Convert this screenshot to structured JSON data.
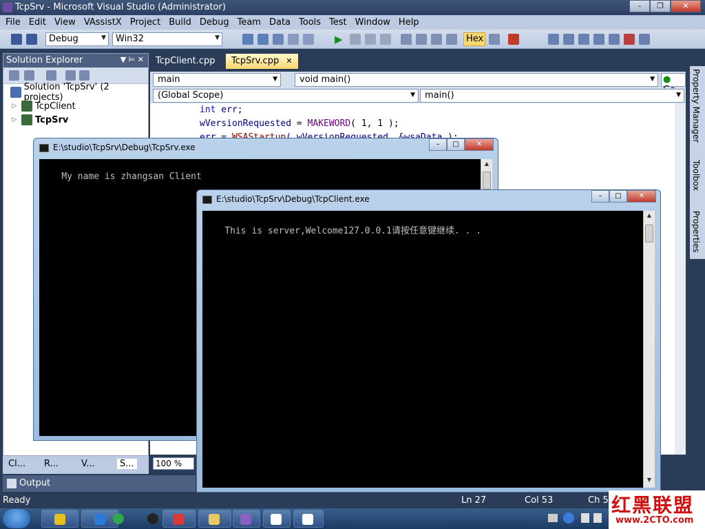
{
  "window": {
    "title": "TcpSrv - Microsoft Visual Studio (Administrator)"
  },
  "menu": [
    "File",
    "Edit",
    "View",
    "VAssistX",
    "Project",
    "Build",
    "Debug",
    "Team",
    "Data",
    "Tools",
    "Test",
    "Window",
    "Help"
  ],
  "toolbar": {
    "config": "Debug",
    "platform": "Win32",
    "hex_label": "Hex"
  },
  "solution_explorer": {
    "title": "Solution Explorer",
    "solution": "Solution 'TcpSrv' (2 projects)",
    "projects": [
      "TcpClient",
      "TcpSrv"
    ]
  },
  "bottom_tabs": [
    "Cl...",
    "R...",
    "V...",
    "S..."
  ],
  "doc_tabs": [
    "TcpClient.cpp",
    "TcpSrv.cpp"
  ],
  "nav": {
    "left": "main",
    "right": "void main()",
    "scope": "(Global Scope)",
    "member": "main()",
    "go": "Go"
  },
  "code": {
    "l1_kw": "int",
    "l1_rest": " err;",
    "l2_ident": "wVersionRequested",
    "l2_eq": " = ",
    "l2_macro": "MAKEWORD",
    "l2_rest": "( 1, 1 );",
    "l3_a": "err = ",
    "l3_fn": "WSAStartup",
    "l3_b": "( wVersionRequested, &wsaData );"
  },
  "right_rail": [
    "Property Manager",
    "Toolbox",
    "Properties"
  ],
  "zoom": "100 %",
  "output": "Output",
  "status": {
    "ready": "Ready",
    "ln": "Ln 27",
    "col": "Col 53",
    "ch": "Ch 50"
  },
  "console_server": {
    "title": "E:\\studio\\TcpSrv\\Debug\\TcpSrv.exe",
    "line": "My name is zhangsan Client"
  },
  "console_client": {
    "title": "E:\\studio\\TcpSrv\\Debug\\TcpClient.exe",
    "line": "This is server,Welcome127.0.0.1请按任意键继续. . ."
  },
  "watermark": {
    "big": "红黑联盟",
    "small": "www.2CTO.com"
  }
}
